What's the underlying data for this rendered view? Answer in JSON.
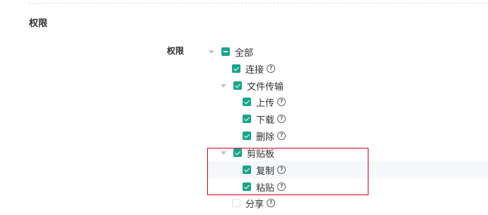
{
  "section": {
    "title": "权限"
  },
  "field": {
    "label": "权限"
  },
  "tree": {
    "root": {
      "label": "全部",
      "state": "indeterminate"
    },
    "connect": {
      "label": "连接",
      "state": "checked"
    },
    "file_transfer": {
      "label": "文件传输",
      "state": "checked",
      "children": {
        "upload": {
          "label": "上传",
          "state": "checked"
        },
        "download": {
          "label": "下载",
          "state": "checked"
        },
        "delete": {
          "label": "删除",
          "state": "checked"
        }
      }
    },
    "clipboard": {
      "label": "剪贴板",
      "state": "checked",
      "children": {
        "copy": {
          "label": "复制",
          "state": "checked"
        },
        "paste": {
          "label": "粘贴",
          "state": "checked"
        }
      }
    },
    "share": {
      "label": "分享",
      "state": "unchecked"
    }
  },
  "icons": {
    "help": "question-circle-icon",
    "help_glyph": "?",
    "expand": "caret-down-icon"
  },
  "colors": {
    "accent": "#1aa58a",
    "highlight": "#d0021b"
  }
}
